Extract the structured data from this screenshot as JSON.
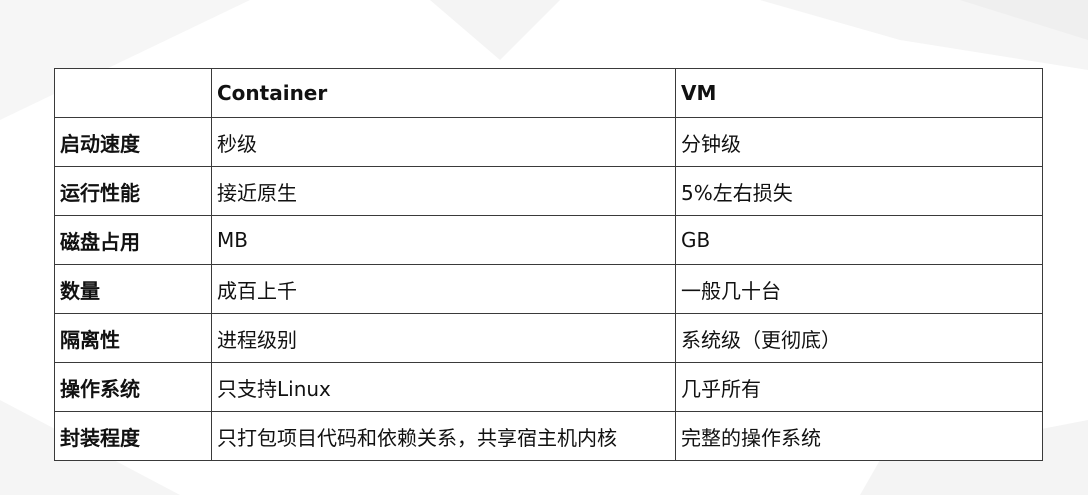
{
  "table": {
    "headers": [
      "",
      "Container",
      "VM"
    ],
    "rows": [
      [
        "启动速度",
        "秒级",
        "分钟级"
      ],
      [
        "运行性能",
        "接近原生",
        "5%左右损失"
      ],
      [
        "磁盘占用",
        "MB",
        "GB"
      ],
      [
        "数量",
        "成百上千",
        "一般几十台"
      ],
      [
        "隔离性",
        "进程级别",
        "系统级（更彻底）"
      ],
      [
        "操作系统",
        "只支持Linux",
        "几乎所有"
      ],
      [
        "封装程度",
        "只打包项目代码和依赖关系，共享宿主机内核",
        "完整的操作系统"
      ]
    ]
  },
  "colors": {
    "background": "#ffffff",
    "background_shape": "#f3f3f3",
    "border": "#3a3a3a",
    "text": "#111111"
  }
}
